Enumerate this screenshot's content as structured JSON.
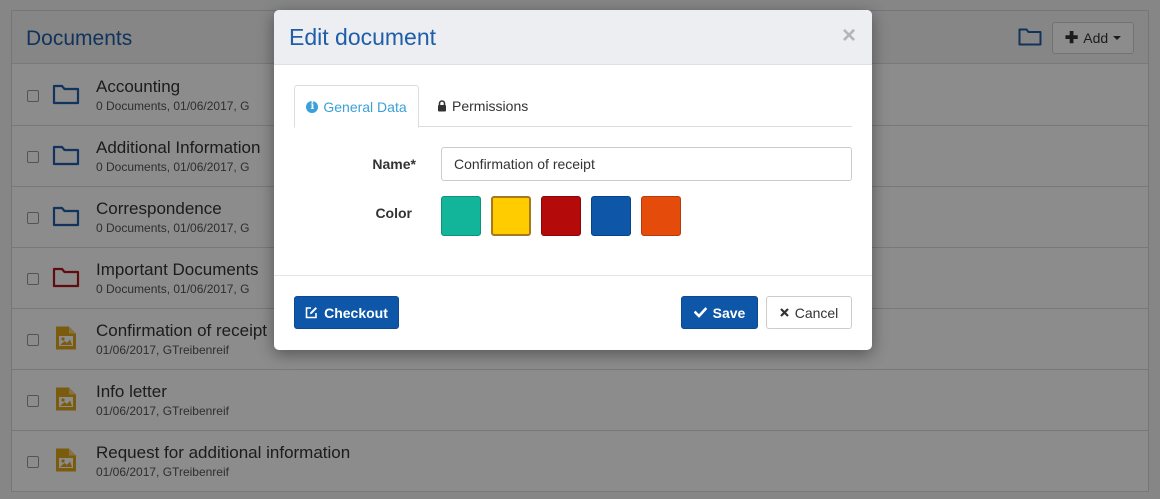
{
  "documents": {
    "title": "Documents",
    "add_label": "Add",
    "rows": [
      {
        "name": "Accounting",
        "meta": "0 Documents, 01/06/2017, G",
        "type": "folder",
        "color": "#1f5ea8"
      },
      {
        "name": "Additional Information",
        "meta": "0 Documents, 01/06/2017, G",
        "type": "folder",
        "color": "#1f5ea8"
      },
      {
        "name": "Correspondence",
        "meta": "0 Documents, 01/06/2017, G",
        "type": "folder",
        "color": "#1f5ea8"
      },
      {
        "name": "Important Documents",
        "meta": "0 Documents, 01/06/2017, G",
        "type": "folder",
        "color": "#b0141c"
      },
      {
        "name": "Confirmation of receipt",
        "meta": "01/06/2017, GTreibenreif",
        "type": "image-file",
        "color": "#e0a81c"
      },
      {
        "name": "Info letter",
        "meta": "01/06/2017, GTreibenreif",
        "type": "image-file",
        "color": "#e0a81c"
      },
      {
        "name": "Request for additional information",
        "meta": "01/06/2017, GTreibenreif",
        "type": "image-file",
        "color": "#e0a81c"
      }
    ]
  },
  "modal": {
    "title": "Edit document",
    "close_glyph": "×",
    "tabs": [
      {
        "label": "General Data",
        "icon": "info-icon",
        "active": true
      },
      {
        "label": "Permissions",
        "icon": "lock-icon",
        "active": false
      }
    ],
    "name_label": "Name*",
    "name_value": "Confirmation of receipt",
    "color_label": "Color",
    "colors": [
      {
        "hex": "#12b59a",
        "border": "#0e927c"
      },
      {
        "hex": "#ffcc00",
        "border": "#a7791d"
      },
      {
        "hex": "#b50a0a",
        "border": "#8c0808"
      },
      {
        "hex": "#0d56a8",
        "border": "#0a4386"
      },
      {
        "hex": "#e54b0b",
        "border": "#b83c09"
      }
    ],
    "checkout_label": "Checkout",
    "save_label": "Save",
    "cancel_label": "Cancel"
  }
}
